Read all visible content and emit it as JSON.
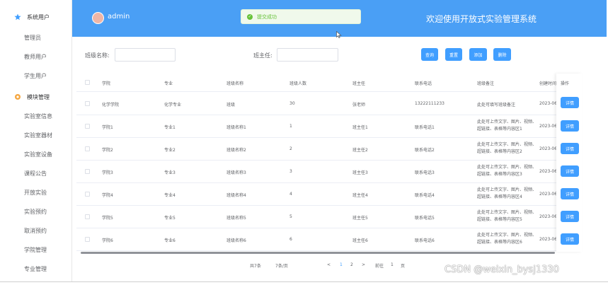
{
  "sidebar": {
    "items": [
      {
        "label": "系统用户",
        "type": "group",
        "icon": "star-icon"
      },
      {
        "label": "管理员",
        "type": "sub"
      },
      {
        "label": "教师用户",
        "type": "sub"
      },
      {
        "label": "学生用户",
        "type": "sub"
      },
      {
        "label": "模块管理",
        "type": "group",
        "icon": "gear-icon"
      },
      {
        "label": "实验室信息",
        "type": "sub"
      },
      {
        "label": "实验室器材",
        "type": "sub"
      },
      {
        "label": "实验室设备",
        "type": "sub"
      },
      {
        "label": "课程公告",
        "type": "sub"
      },
      {
        "label": "开放实验",
        "type": "sub"
      },
      {
        "label": "实验预约",
        "type": "sub"
      },
      {
        "label": "取消预约",
        "type": "sub"
      },
      {
        "label": "学院管理",
        "type": "sub"
      },
      {
        "label": "专业管理",
        "type": "sub"
      }
    ]
  },
  "header": {
    "username": "admin",
    "title": "欢迎使用开放式实验管理系统",
    "toast": "提交成功"
  },
  "search": {
    "class_name_label": "班级名称:",
    "class_name_value": "",
    "teacher_label": "班主任:",
    "teacher_value": "",
    "buttons": [
      "查询",
      "重置",
      "添加",
      "删除"
    ]
  },
  "table": {
    "headers": [
      "学院",
      "专业",
      "班级名称",
      "班级人数",
      "班主任",
      "联系电话",
      "班级备注",
      "创建时间",
      "操作"
    ],
    "rows": [
      {
        "college": "化学学院",
        "major": "化学专业",
        "class": "班级",
        "count": "30",
        "teacher": "张老师",
        "phone": "13222111233",
        "note": "此处可填写班级备注",
        "created": "2023-06",
        "action": "详情"
      },
      {
        "college": "学院1",
        "major": "专业1",
        "class": "班级名称1",
        "count": "1",
        "teacher": "班主任1",
        "phone": "联系电话1",
        "note": "此处可上传文字、图片、视频、超链接、表格等内容区1",
        "created": "2023-06",
        "action": "详情"
      },
      {
        "college": "学院2",
        "major": "专业2",
        "class": "班级名称2",
        "count": "2",
        "teacher": "班主任2",
        "phone": "联系电话2",
        "note": "此处可上传文字、图片、视频、超链接、表格等内容区2",
        "created": "2023-06",
        "action": "详情"
      },
      {
        "college": "学院3",
        "major": "专业3",
        "class": "班级名称3",
        "count": "3",
        "teacher": "班主任3",
        "phone": "联系电话3",
        "note": "此处可上传文字、图片、视频、超链接、表格等内容区3",
        "created": "2023-06",
        "action": "详情"
      },
      {
        "college": "学院4",
        "major": "专业4",
        "class": "班级名称4",
        "count": "4",
        "teacher": "班主任4",
        "phone": "联系电话4",
        "note": "此处可上传文字、图片、视频、超链接、表格等内容区4",
        "created": "2023-06",
        "action": "详情"
      },
      {
        "college": "学院5",
        "major": "专业5",
        "class": "班级名称5",
        "count": "5",
        "teacher": "班主任5",
        "phone": "联系电话5",
        "note": "此处可上传文字、图片、视频、超链接、表格等内容区5",
        "created": "2023-06",
        "action": "详情"
      },
      {
        "college": "学院6",
        "major": "专业6",
        "class": "班级名称6",
        "count": "6",
        "teacher": "班主任6",
        "phone": "联系电话6",
        "note": "此处可上传文字、图片、视频、超链接、表格等内容区6",
        "created": "2023-06",
        "action": "详情"
      }
    ]
  },
  "pagination": {
    "total": "共7条",
    "page_size": "7条/页",
    "prev": "<",
    "pages": [
      "1",
      "2"
    ],
    "active_page": "1",
    "next": ">",
    "goto_label": "前往",
    "goto_value": "1",
    "goto_suffix": "页"
  },
  "watermark": "CSDN @weixin_bysj1330",
  "colors": {
    "header": "#4a9ff5",
    "primary": "#409eff",
    "success": "#67c23a"
  }
}
